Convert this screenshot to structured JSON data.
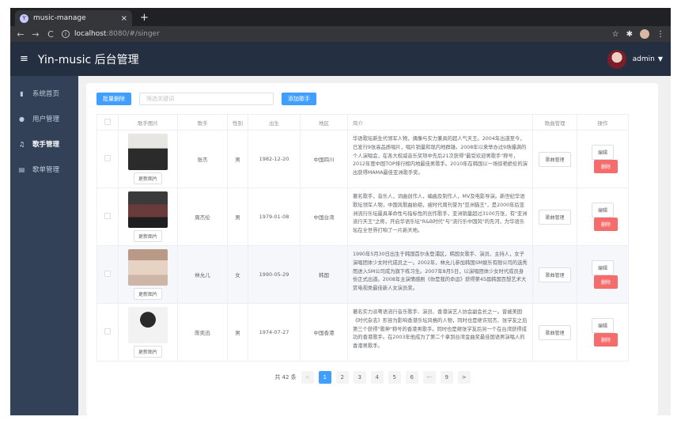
{
  "browser": {
    "tab_title": "music-manage",
    "tab_close": "×",
    "new_tab": "+",
    "url_host": "localhost",
    "url_path": ":8080/#/singer"
  },
  "header": {
    "title": "Yin-music 后台管理",
    "username": "admin"
  },
  "sidebar": {
    "items": [
      {
        "label": "系统首页"
      },
      {
        "label": "用户管理"
      },
      {
        "label": "歌手管理"
      },
      {
        "label": "歌单管理"
      }
    ]
  },
  "toolbar": {
    "batch_delete": "批量删除",
    "search_placeholder": "筛选关键词",
    "add_singer": "添加歌手"
  },
  "table": {
    "headers": [
      "歌手图片",
      "歌手",
      "性别",
      "出生",
      "地区",
      "简介",
      "歌曲管理",
      "操作"
    ],
    "update_image_label": "更新图片",
    "song_manage_label": "歌曲管理",
    "edit_label": "编辑",
    "delete_label": "删除",
    "rows": [
      {
        "name": "张杰",
        "gender": "男",
        "birth": "1982-12-20",
        "region": "中国四川",
        "intro": "华语歌坛新生代领军人物，偶像与实力兼具的超人气天王。2004年出道至今，已发行9张高品质唱片，唱片销量和现内地群雄。2008年以来举办过9场爆满的个人演唱会，在各大权威音乐奖项中先后21次获得\"最受欢迎男歌手\"称号，2012年度中国TOP排行榜内地最佳男歌手。2010年在韩国以一场惊艳绝伦的演出获得MAMA最佳亚洲歌手奖。"
      },
      {
        "name": "周杰伦",
        "gender": "男",
        "birth": "1979-01-08",
        "region": "中国台湾",
        "intro": "著名歌手，音乐人，词曲创作人，编曲及制作人，MV及电影导演。新世纪华语歌坛领军人物，中国风歌曲始祖，被时代周刊誉为\"亚洲猫王\"，是2000年后亚洲流行乐坛最具革命性与指标性的创作歌手，亚洲销量超过3100万张，有\"亚洲流行天王\"之称，开启华语乐坛\"R&B时代\"与\"流行乐中国风\"的先河，为华语乐坛在全世界打响了一片新天地。"
      },
      {
        "name": "林允儿",
        "gender": "女",
        "birth": "1990-05-29",
        "region": "韩国",
        "intro": "1990年5月30日出生于韩国首尔永登浦区，韩国女歌手、演员、主持人，女子演唱团体少女时代成员之一。2002年，林允儿参加韩国SM娱乐有限公司的选秀而进入SM公司成为旗下练习生。2007年8月5日，以演唱团体少女时代成员身份正式出道。2008年主演情感剧《你是我的命运》获得第45届韩国百想艺术大赏电视类最佳新人女演员奖。"
      },
      {
        "name": "陈奕迅",
        "gender": "男",
        "birth": "1974-07-27",
        "region": "中国香港",
        "intro": "著名实力派粤语流行音乐歌手、演员、香港演艺人协会副会长之一。曾被美国《时代杂志》形容为影响香港乐坛风格的人物，同时也是继许冠杰、张学友之后第三个获得\"歌神\"称号的香港男歌手。同时也是继张学友后另一个在台湾获得成功的香港歌手。在2003年他成为了第二个拿到台湾金曲奖最佳国语男演唱人的香港男歌手。"
      }
    ]
  },
  "pagination": {
    "total": "共 42 条",
    "prev": "<",
    "next": ">",
    "pages": [
      "1",
      "2",
      "3",
      "4",
      "5",
      "6",
      "···",
      "9"
    ]
  }
}
